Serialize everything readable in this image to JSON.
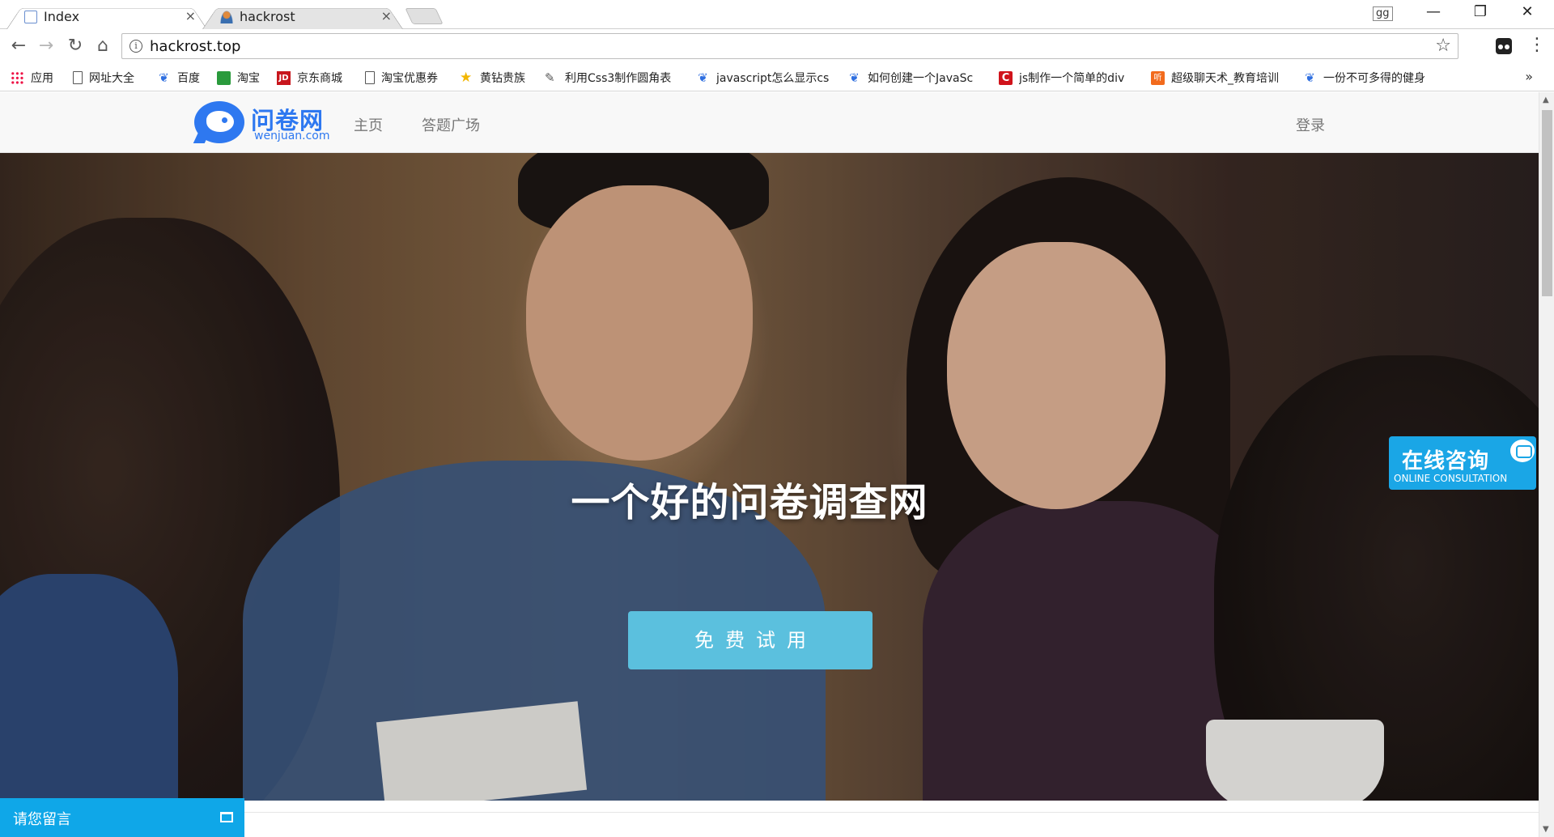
{
  "browser": {
    "tabs": [
      {
        "title": "Index",
        "active": true
      },
      {
        "title": "hackrost",
        "active": false
      }
    ],
    "profile_label": "gg",
    "window_controls": {
      "minimize": "—",
      "restore": "❐",
      "close": "✕"
    },
    "url": "hackrost.top",
    "nav": {
      "back": "←",
      "forward": "→",
      "reload": "↻",
      "home": "⌂",
      "star": "☆",
      "menu": "⋮"
    },
    "bookmarks": [
      {
        "label": "应用",
        "icon": "apps-grid-icon"
      },
      {
        "label": "网址大全",
        "icon": "page-icon"
      },
      {
        "label": "百度",
        "icon": "baidu-paw-icon"
      },
      {
        "label": "淘宝",
        "icon": "taobao-icon"
      },
      {
        "label": "京东商城",
        "icon": "jd-icon"
      },
      {
        "label": "淘宝优惠券",
        "icon": "page-icon"
      },
      {
        "label": "黄钻贵族",
        "icon": "star-icon"
      },
      {
        "label": "利用Css3制作圆角表",
        "icon": "css3-icon"
      },
      {
        "label": "javascript怎么显示cs",
        "icon": "baidu-paw-icon"
      },
      {
        "label": "如何创建一个JavaSc",
        "icon": "baidu-paw-icon"
      },
      {
        "label": "js制作一个简单的div",
        "icon": "csdn-icon"
      },
      {
        "label": "超级聊天术_教育培训",
        "icon": "ting-icon"
      },
      {
        "label": "一份不可多得的健身",
        "icon": "baidu-paw-icon"
      }
    ],
    "bookmarks_overflow": "»"
  },
  "site": {
    "logo": {
      "cn": "问卷网",
      "en": "wenjuan.com"
    },
    "nav": [
      "主页",
      "答题广场"
    ],
    "login": "登录",
    "hero": {
      "title": "一个好的问卷调查网",
      "cta": "免费试用"
    },
    "consult": {
      "cn": "在线咨询",
      "en": "ONLINE CONSULTATION"
    },
    "message_bar": "请您留言"
  },
  "colors": {
    "brand_blue": "#2e78f0",
    "cta": "#5bc0de",
    "consult": "#1aa6e6",
    "message_bar": "#0fa7e8"
  }
}
